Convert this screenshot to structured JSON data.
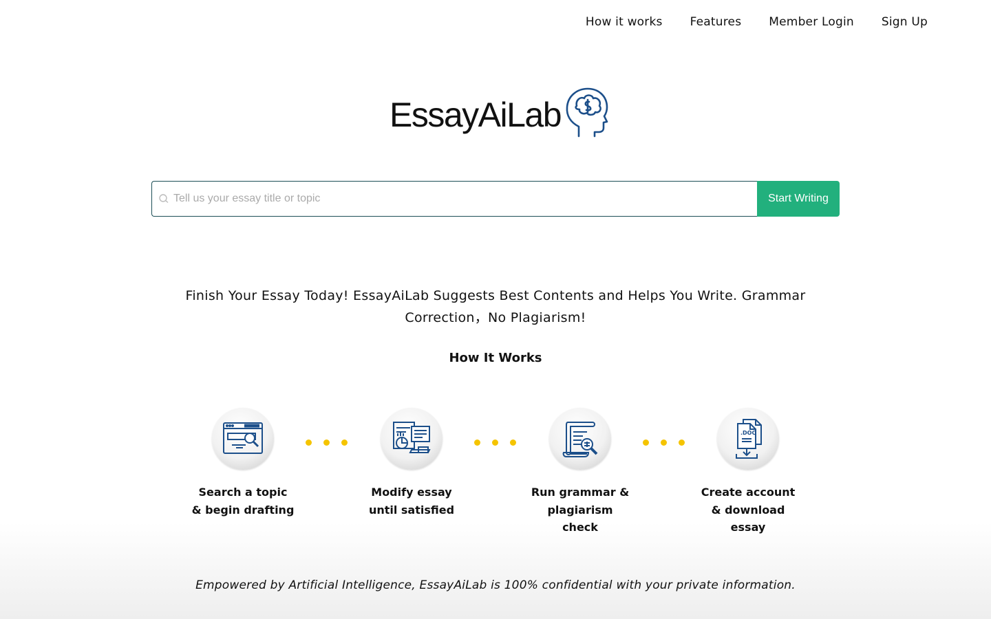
{
  "nav": {
    "items": [
      "How it works",
      "Features",
      "Member Login",
      "Sign Up"
    ]
  },
  "logo": {
    "text": "EssayAiLab",
    "icon": "brain-head-icon"
  },
  "search": {
    "placeholder": "Tell us your essay title or topic",
    "value": "",
    "button_label": "Start Writing"
  },
  "tagline": "Finish Your Essay Today! EssayAiLab Suggests Best Contents and Helps You Write. Grammar Correction，No Plagiarism!",
  "how_it_works": {
    "title": "How It Works",
    "steps": [
      {
        "label": "Search a topic\n& begin drafting",
        "icon": "browser-search-icon"
      },
      {
        "label": "Modify essay\nuntil satisfied",
        "icon": "document-edit-icon"
      },
      {
        "label": "Run grammar &\nplagiarism\ncheck",
        "icon": "scroll-magnifier-icon"
      },
      {
        "label": "Create account\n& download\nessay",
        "icon": "doc-download-icon"
      }
    ]
  },
  "footer_note": "Empowered by Artificial Intelligence, EssayAiLab is 100% confidential with your private information.",
  "colors": {
    "accent": "#22b07d",
    "icon_blue": "#1c4f8a",
    "dots": "#f5c400"
  }
}
